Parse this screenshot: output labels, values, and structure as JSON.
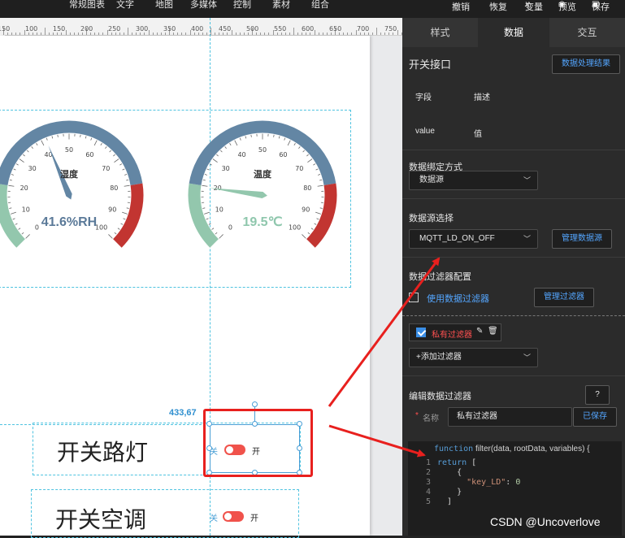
{
  "toolbar": {
    "menu": [
      "常规图表",
      "文字",
      "地图",
      "多媒体",
      "控制",
      "素材",
      "组合"
    ],
    "undo": "撤销",
    "redo": "恢复",
    "variable": "变量",
    "preview": "预览",
    "save": "保存"
  },
  "ruler": {
    "labels": [
      "150",
      "100",
      "150",
      "200",
      "250",
      "300",
      "350",
      "400",
      "450",
      "500",
      "550",
      "600",
      "650",
      "700",
      "750"
    ]
  },
  "canvas": {
    "coord_readout": "433,67",
    "gauges": [
      {
        "title": "湿度",
        "value_text": "41.6%RH",
        "min": 0,
        "max": 100,
        "value": 41.6,
        "ticks": [
          "0",
          "10",
          "20",
          "30",
          "40",
          "50",
          "60",
          "70",
          "80",
          "90",
          "100"
        ]
      },
      {
        "title": "温度",
        "value_text": "19.5℃",
        "min": 0,
        "max": 100,
        "value": 19.5,
        "ticks": [
          "0",
          "10",
          "20",
          "30",
          "40",
          "50",
          "60",
          "70",
          "80",
          "90",
          "100"
        ]
      }
    ],
    "switches": [
      {
        "label": "开关路灯",
        "off_text": "关",
        "on_text": "开"
      },
      {
        "label": "开关空调",
        "off_text": "关",
        "on_text": "开"
      }
    ]
  },
  "panel": {
    "tabs": [
      "样式",
      "数据",
      "交互"
    ],
    "active_tab": "数据",
    "interface_title": "开关接口",
    "result_button": "数据处理结果",
    "fields": {
      "header_field": "字段",
      "header_desc": "描述",
      "field": "value",
      "desc": "值"
    },
    "binding_label": "数据绑定方式",
    "binding_value": "数据源",
    "source_label": "数据源选择",
    "source_value": "MQTT_LD_ON_OFF",
    "manage_source": "管理数据源",
    "filter_config_label": "数据过滤器配置",
    "use_filter": "使用数据过滤器",
    "manage_filter": "管理过滤器",
    "private_filter": "私有过滤器",
    "add_filter": "+添加过滤器",
    "edit_filter_label": "编辑数据过滤器",
    "help": "?",
    "name_label": "名称",
    "required_mark": "*",
    "name_value": "私有过滤器",
    "saved": "已保存",
    "code": {
      "signature_kw": "function",
      "signature_rest": " filter(data, rootData, variables) {",
      "lines": [
        "  return [",
        "    {",
        "      \"key_LD\": 0",
        "    }",
        "  ]"
      ],
      "line_numbers": [
        "1",
        "2",
        "3",
        "4",
        "5"
      ]
    }
  },
  "watermark": "CSDN @Uncoverlove",
  "colors": {
    "gauge_blue": "#6386a4",
    "gauge_green": "#93c7ad",
    "gauge_red": "#c23531",
    "switch_red": "#f0524b",
    "accent_blue": "#54a6ff",
    "highlight_red": "#e8201e"
  }
}
